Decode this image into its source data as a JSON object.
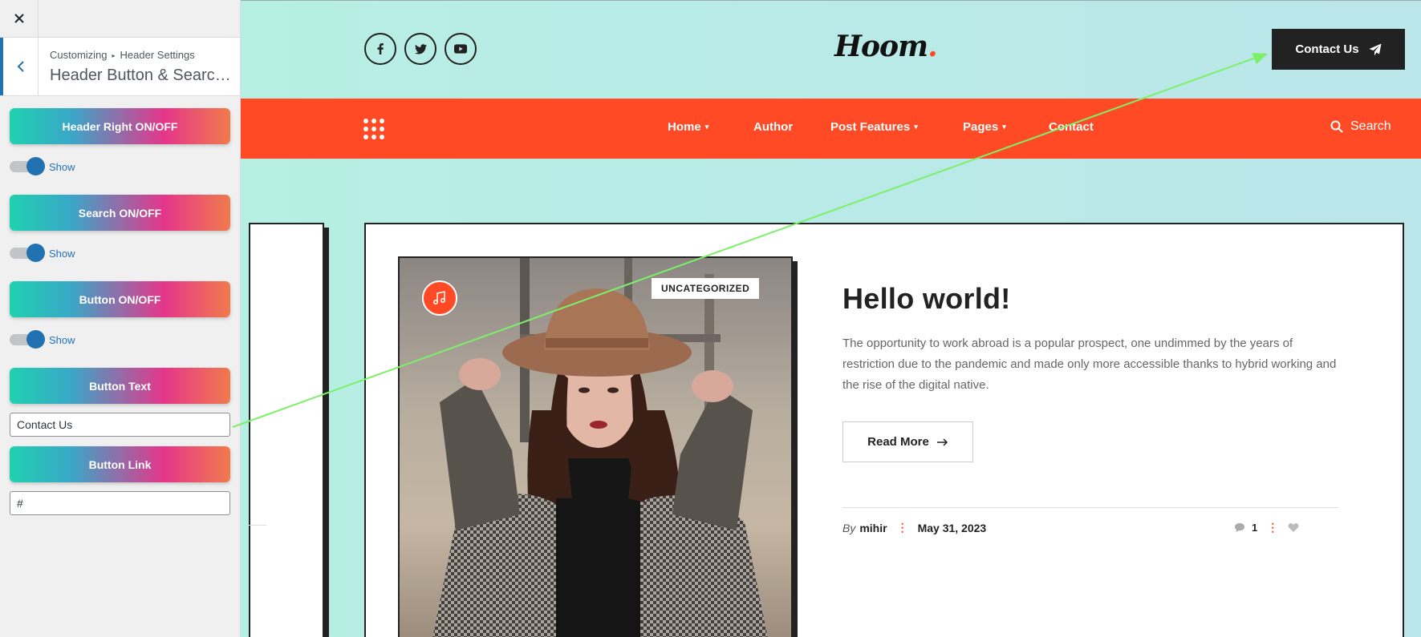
{
  "colors": {
    "accent": "#ff4a25",
    "dark": "#222222",
    "wp_blue": "#2271b1",
    "preview_bg": "#b9ede5",
    "arrow": "#7df06a"
  },
  "customizer": {
    "breadcrumb": [
      "Customizing",
      "Header Settings"
    ],
    "section_title": "Header Button & Search ...",
    "controls": {
      "header_right": {
        "heading": "Header Right ON/OFF",
        "toggle_label": "Show",
        "on": true
      },
      "search": {
        "heading": "Search ON/OFF",
        "toggle_label": "Show",
        "on": true
      },
      "button": {
        "heading": "Button ON/OFF",
        "toggle_label": "Show",
        "on": true
      },
      "button_text": {
        "heading": "Button Text",
        "value": "Contact Us"
      },
      "button_link": {
        "heading": "Button Link",
        "value": "#"
      }
    }
  },
  "site": {
    "logo_text": "Hoom",
    "logo_dot": ".",
    "social_icons": [
      "facebook-icon",
      "twitter-icon",
      "youtube-icon"
    ],
    "contact_button": "Contact Us",
    "nav": [
      {
        "label": "Home",
        "has_dropdown": true
      },
      {
        "label": "Author",
        "has_dropdown": false
      },
      {
        "label": "Post Features",
        "has_dropdown": true
      },
      {
        "label": "Pages",
        "has_dropdown": true
      },
      {
        "label": "Contact",
        "has_dropdown": false
      }
    ],
    "search_label": "Search"
  },
  "post": {
    "category": "UNCATEGORIZED",
    "title": "Hello world!",
    "excerpt": "The opportunity to work abroad is a popular prospect, one undimmed by the years of restriction due to the pandemic and made only more accessible thanks to hybrid working and the rise of the digital native.",
    "read_more": "Read More",
    "by": "By",
    "author": "mihir",
    "date": "May 31, 2023",
    "comments": "1"
  }
}
